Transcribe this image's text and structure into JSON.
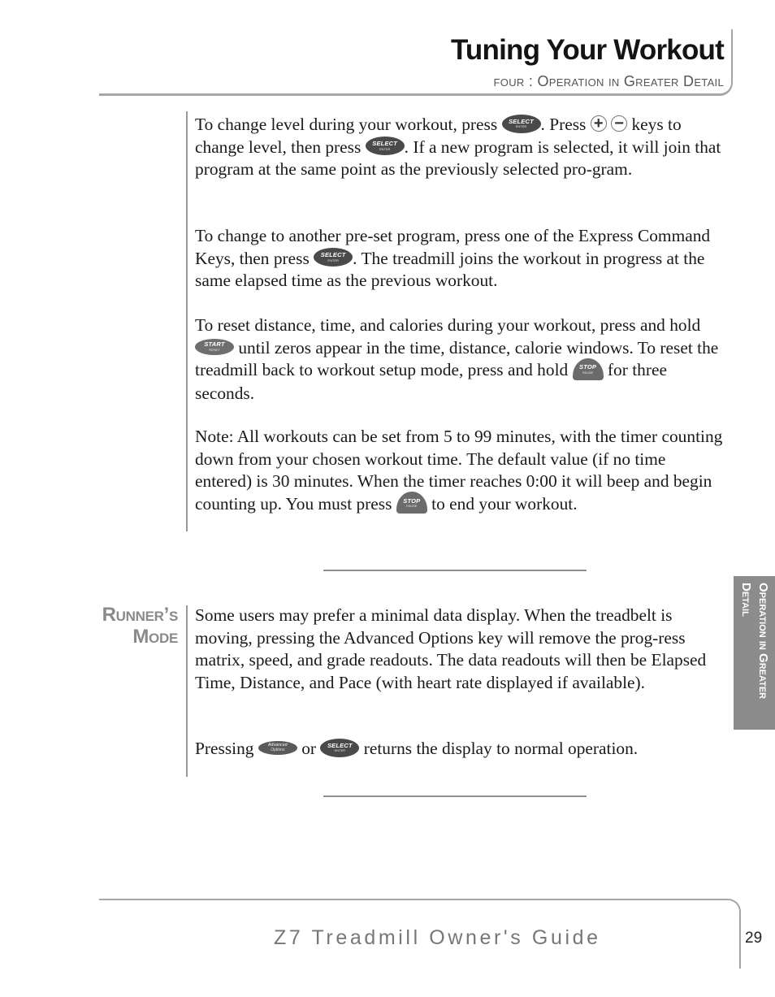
{
  "header": {
    "title": "Tuning Your Workout",
    "subtitle": "four : Operation in Greater Detail"
  },
  "keys": {
    "select": {
      "line1": "SELECT",
      "line2": "ENTER"
    },
    "start": {
      "line1": "START",
      "line2": "RESET"
    },
    "stop": {
      "line1": "STOP",
      "line2": "PAUSE"
    },
    "advanced": {
      "line1": "Advanced",
      "line2": "Options"
    },
    "plus": "+",
    "minus": "−"
  },
  "paragraphs": {
    "p1": {
      "t1": "To change level during your workout, press ",
      "t2": ". Press ",
      "t3": " keys to change level, then press ",
      "t4": ". If a new program is selected, it will join that program at the same point as the previously selected pro-gram."
    },
    "p2": {
      "t1": "To change to another pre-set program, press one of the Express Command Keys, then press ",
      "t2": ". The treadmill joins the workout in progress at the same elapsed time as the previous workout."
    },
    "p3": {
      "t1": "To reset distance, time, and calories during your workout, press and hold ",
      "t2": " until zeros appear in the time, distance, calorie windows. To reset the treadmill back to workout setup mode, press and hold ",
      "t3": " for three seconds."
    },
    "p4": {
      "t1": "Note: All workouts can be set from 5 to 99 minutes, with the timer counting down from your chosen workout time. The default value (if no time entered) is 30 minutes. When the timer reaches 0:00 it will beep and begin counting up. You must press ",
      "t2": " to end your workout."
    }
  },
  "runners_mode": {
    "heading_line1": "Runner’s",
    "heading_line2": "Mode",
    "p1": "Some users may prefer a minimal data display. When the treadbelt is moving, pressing the Advanced Options key will remove the prog-ress matrix, speed, and grade readouts. The data readouts will then be Elapsed Time, Distance, and Pace (with heart rate displayed if available).",
    "p2": {
      "t1": "Pressing ",
      "t2": " or ",
      "t3": " returns the display to normal operation."
    }
  },
  "side_tab": {
    "label": "Operation in Greater Detail"
  },
  "footer": {
    "guide_title": "Z7 Treadmill Owner's Guide",
    "page_number": "29"
  }
}
